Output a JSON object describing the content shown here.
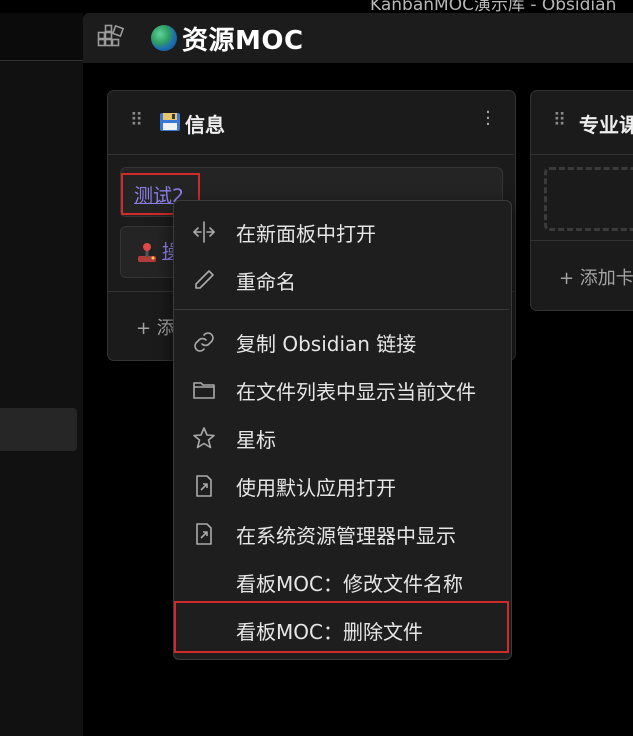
{
  "window": {
    "title": "KanbanMOC演示库 - Obsidian"
  },
  "header": {
    "title": "资源MOC",
    "board_icon": "kanban-board-icon",
    "title_icon": "globe-icon"
  },
  "lanes": [
    {
      "title": "信息",
      "icon": "floppy-disk-icon",
      "cards": [
        {
          "link": "测试2"
        },
        {
          "icon": "joystick-icon",
          "link": "操"
        }
      ],
      "add_label": "+ 添加卡片"
    },
    {
      "title": "专业课",
      "cards": [],
      "add_label": "+ 添加卡片"
    }
  ],
  "context_menu": {
    "items": [
      {
        "label": "在新面板中打开",
        "icon": "split-pane-icon"
      },
      {
        "label": "重命名",
        "icon": "pencil-icon"
      },
      {
        "label": "复制 Obsidian 链接",
        "icon": "link-icon"
      },
      {
        "label": "在文件列表中显示当前文件",
        "icon": "folder-icon"
      },
      {
        "label": "星标",
        "icon": "star-icon"
      },
      {
        "label": "使用默认应用打开",
        "icon": "open-external-icon"
      },
      {
        "label": "在系统资源管理器中显示",
        "icon": "open-external-icon"
      },
      {
        "label": "看板MOC：修改文件名称",
        "icon": ""
      },
      {
        "label": "看板MOC：删除文件",
        "icon": ""
      }
    ]
  },
  "colors": {
    "link": "#8c7ee8",
    "highlight": "#d02a2a",
    "menu_bg": "#1e1e1e",
    "lane_bg": "#1b1b1b"
  }
}
